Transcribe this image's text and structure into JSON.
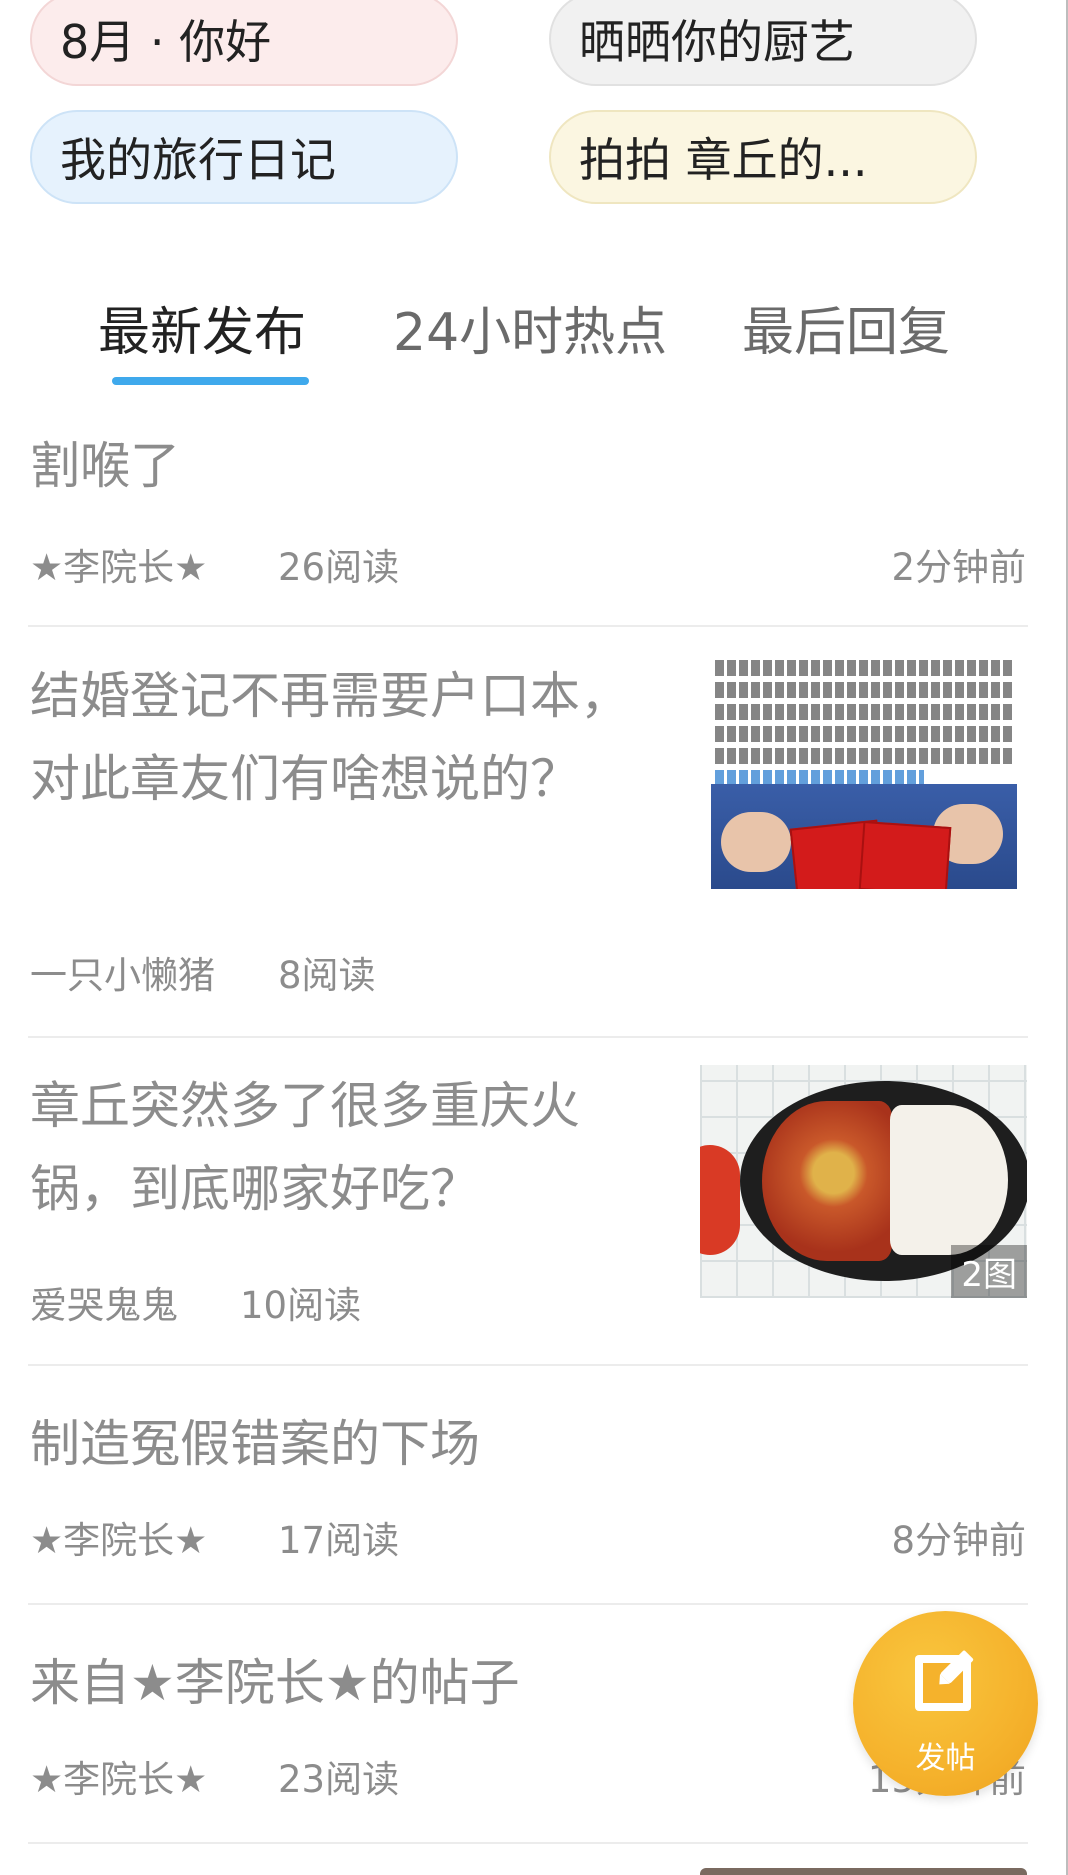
{
  "topics": [
    {
      "label": "8月 · 你好"
    },
    {
      "label": "晒晒你的厨艺"
    },
    {
      "label": "我的旅行日记"
    },
    {
      "label": "拍拍 章丘的..."
    }
  ],
  "tabs": [
    {
      "label": "最新发布",
      "active": true
    },
    {
      "label": "24小时热点",
      "active": false
    },
    {
      "label": "最后回复",
      "active": false
    }
  ],
  "colors": {
    "accent": "#3fa9ec",
    "fab": "#f5b22c",
    "muted_text": "#8c8c8c"
  },
  "posts": [
    {
      "title": "割喉了",
      "author": "★李院长★",
      "reads": "26阅读",
      "time": "2分钟前"
    },
    {
      "title": "结婚登记不再需要户口本，对此章友们有啥想说的？",
      "author": "一只小懒猪",
      "reads": "8阅读",
      "time": ""
    },
    {
      "title": "章丘突然多了很多重庆火锅，到底哪家好吃？",
      "author": "爱哭鬼鬼",
      "reads": "10阅读",
      "time": "",
      "image_count": "2图"
    },
    {
      "title": "制造冤假错案的下场",
      "author": "★李院长★",
      "reads": "17阅读",
      "time": "8分钟前"
    },
    {
      "title": "来自★李院长★的帖子",
      "author": "★李院长★",
      "reads": "23阅读",
      "time": "15分钟前"
    }
  ],
  "fab": {
    "label": "发帖",
    "icon": "edit-icon"
  }
}
